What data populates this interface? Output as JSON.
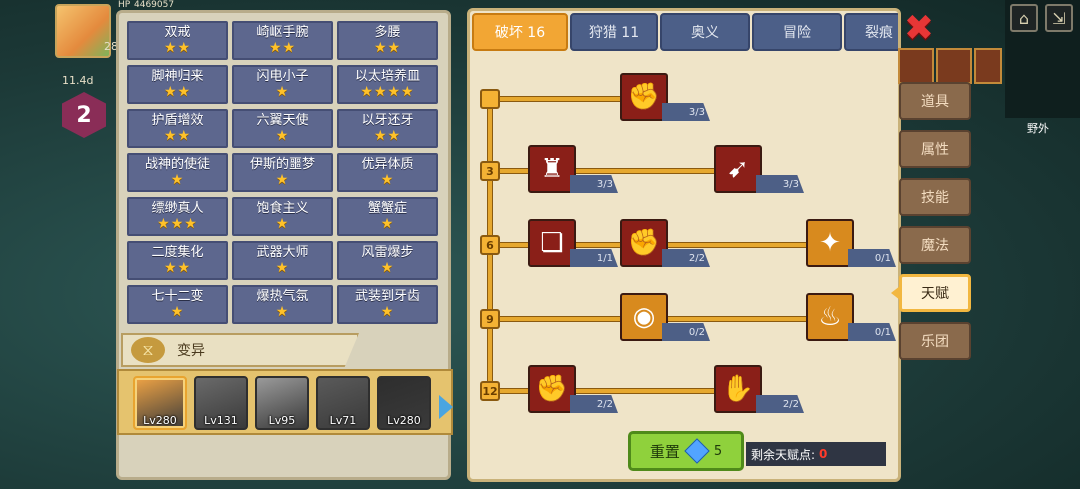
{
  "hud": {
    "hp_label": "HP",
    "hp_value": "4469057",
    "count": "28",
    "timer": "11.4d",
    "level": "2"
  },
  "traits": [
    {
      "name": "双戒",
      "stars": "★★"
    },
    {
      "name": "崎岖手腕",
      "stars": "★★"
    },
    {
      "name": "多腰",
      "stars": "★★"
    },
    {
      "name": "脚神归来",
      "stars": "★★"
    },
    {
      "name": "闪电小子",
      "stars": "★"
    },
    {
      "name": "以太培养皿",
      "stars": "★★★★"
    },
    {
      "name": "护盾增效",
      "stars": "★★"
    },
    {
      "name": "六翼天使",
      "stars": "★"
    },
    {
      "name": "以牙还牙",
      "stars": "★★"
    },
    {
      "name": "战神的使徒",
      "stars": "★"
    },
    {
      "name": "伊斯的噩梦",
      "stars": "★"
    },
    {
      "name": "优异体质",
      "stars": "★"
    },
    {
      "name": "缥缈真人",
      "stars": "★★★"
    },
    {
      "name": "饱食主义",
      "stars": "★"
    },
    {
      "name": "蟹蟹症",
      "stars": "★"
    },
    {
      "name": "二度集化",
      "stars": "★★"
    },
    {
      "name": "武器大师",
      "stars": "★"
    },
    {
      "name": "风雷爆步",
      "stars": "★"
    },
    {
      "name": "七十二变",
      "stars": "★"
    },
    {
      "name": "爆热气氛",
      "stars": "★"
    },
    {
      "name": "武装到牙齿",
      "stars": "★"
    }
  ],
  "mutation_label": "变异",
  "heroes": [
    {
      "lv": "Lv280",
      "color": "#f0a445",
      "selected": true
    },
    {
      "lv": "Lv131",
      "color": "#6a6a6a",
      "selected": false
    },
    {
      "lv": "Lv95",
      "color": "#9a9a9a",
      "selected": false
    },
    {
      "lv": "Lv71",
      "color": "#5a5a5a",
      "selected": false
    },
    {
      "lv": "Lv280",
      "color": "#2e2e2e",
      "selected": false
    }
  ],
  "tabs": [
    {
      "label": "破坏 16",
      "active": true
    },
    {
      "label": "狩猎 11",
      "active": false
    },
    {
      "label": "奥义",
      "active": false
    },
    {
      "label": "冒险",
      "active": false
    },
    {
      "label": "裂痕",
      "active": false
    }
  ],
  "talent_tiers": [
    "3",
    "6",
    "9",
    "12"
  ],
  "talents": [
    {
      "icon": "arm-wrestle-icon",
      "glyph": "✊",
      "style": "red",
      "count": "3/3"
    },
    {
      "icon": "muscle-body-icon",
      "glyph": "♜",
      "style": "red",
      "count": "3/3"
    },
    {
      "icon": "arrow-strike-icon",
      "glyph": "➹",
      "style": "red",
      "count": "3/3"
    },
    {
      "icon": "card-icon",
      "glyph": "❏",
      "style": "red",
      "count": "1/1"
    },
    {
      "icon": "fist-punch-icon",
      "glyph": "✊",
      "style": "red",
      "count": "2/2"
    },
    {
      "icon": "burst-icon",
      "glyph": "✦",
      "style": "gold",
      "count": "0/1"
    },
    {
      "icon": "ring-orb-icon",
      "glyph": "◉",
      "style": "gold",
      "count": "0/2"
    },
    {
      "icon": "flame-drop-icon",
      "glyph": "♨",
      "style": "gold",
      "count": "0/1"
    },
    {
      "icon": "raised-fist-icon",
      "glyph": "✊",
      "style": "red",
      "count": "2/2"
    },
    {
      "icon": "slash-hand-icon",
      "glyph": "✋",
      "style": "red",
      "count": "2/2"
    }
  ],
  "reset": {
    "label": "重置",
    "cost": "5"
  },
  "points": {
    "label": "剩余天赋点:",
    "value": "0"
  },
  "side_tabs": [
    {
      "label": "道具",
      "active": false
    },
    {
      "label": "属性",
      "active": false
    },
    {
      "label": "技能",
      "active": false
    },
    {
      "label": "魔法",
      "active": false
    },
    {
      "label": "天赋",
      "active": true
    },
    {
      "label": "乐团",
      "active": false
    }
  ],
  "minimap_label": "野外",
  "close_glyph": "✖"
}
